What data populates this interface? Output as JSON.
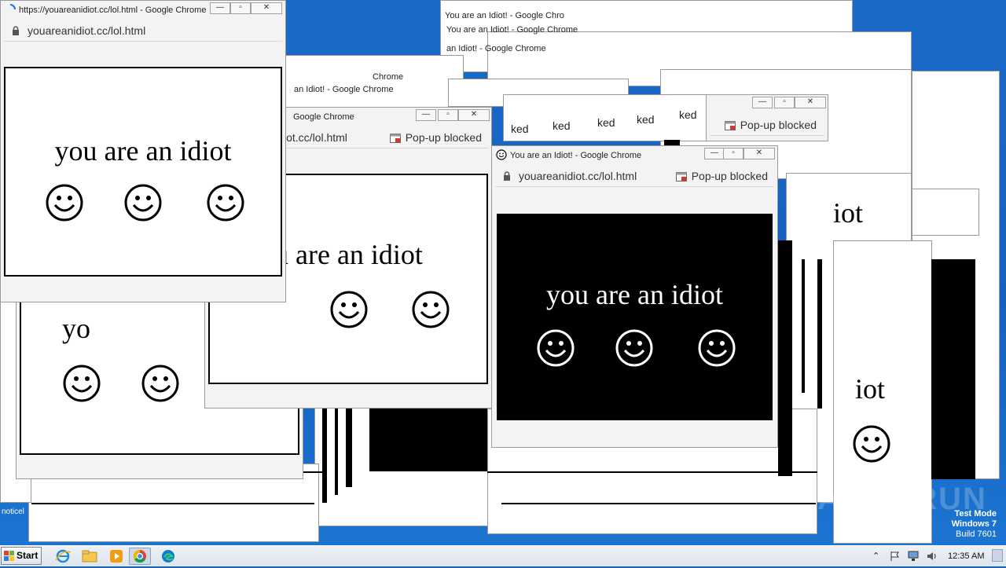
{
  "popup": {
    "title_main": "https://youareanidiot.cc/lol.html - Google Chrome",
    "title_alt": "You are an Idiot! - Google Chrome",
    "title_short": "You are an Idiot! - Google Chro",
    "title_tail": "Chrome",
    "title_frag": "an Idiot! - Google Chrome",
    "url": "youareanidiot.cc/lol.html",
    "url_frag": "iot.cc/lol.html",
    "popup_blocked": "Pop-up blocked",
    "blocked_frag": "ked",
    "idiot_text": "you are an idiot",
    "idiot_frag_a": "u are an idiot",
    "idiot_frag_b": "yo",
    "idiot_frag_c": "iot",
    "buttons": {
      "min": "—",
      "max": "▫",
      "close": "✕"
    }
  },
  "taskbar": {
    "start": "Start",
    "apps": [
      "internet-explorer-icon",
      "explorer-folder-icon",
      "media-player-icon",
      "chrome-icon",
      "edge-icon"
    ],
    "tray_time": "12:35 AM",
    "tray_chevron": "⌃"
  },
  "watermark": {
    "line1": "Test Mode",
    "line2": "Windows 7",
    "line3": "Build 7601"
  },
  "desktop": {
    "icon_label": "noticel"
  },
  "colors": {
    "desktop": "#1560c0",
    "popup_chrome": "#f3f3f3",
    "frame": "#000000"
  }
}
